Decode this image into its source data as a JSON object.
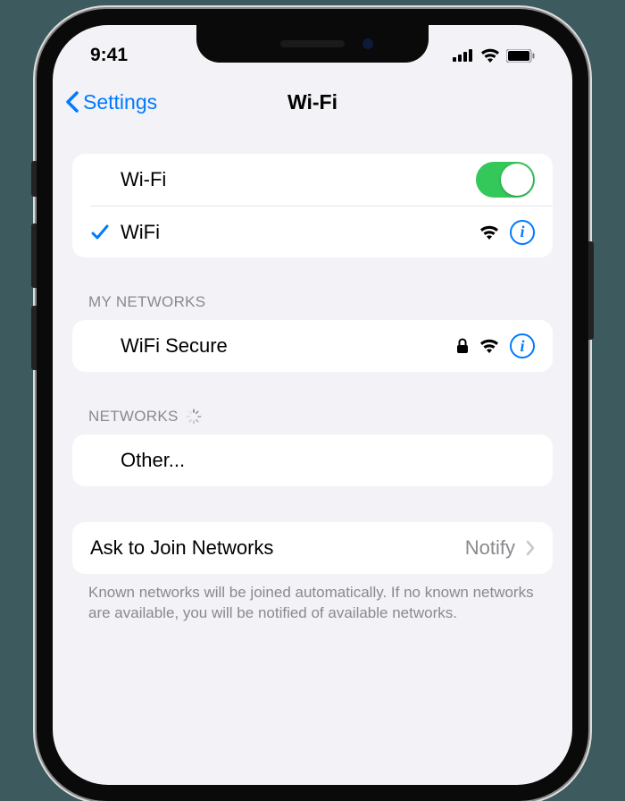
{
  "statusBar": {
    "time": "9:41"
  },
  "nav": {
    "back": "Settings",
    "title": "Wi-Fi"
  },
  "wifi": {
    "toggleLabel": "Wi-Fi",
    "toggleOn": true,
    "connected": {
      "name": "WiFi"
    }
  },
  "myNetworks": {
    "header": "My Networks",
    "items": [
      {
        "name": "WiFi Secure",
        "locked": true
      }
    ]
  },
  "networks": {
    "header": "Networks",
    "other": "Other..."
  },
  "askToJoin": {
    "label": "Ask to Join Networks",
    "value": "Notify",
    "footer": "Known networks will be joined automatically. If no known networks are available, you will be notified of available networks."
  }
}
